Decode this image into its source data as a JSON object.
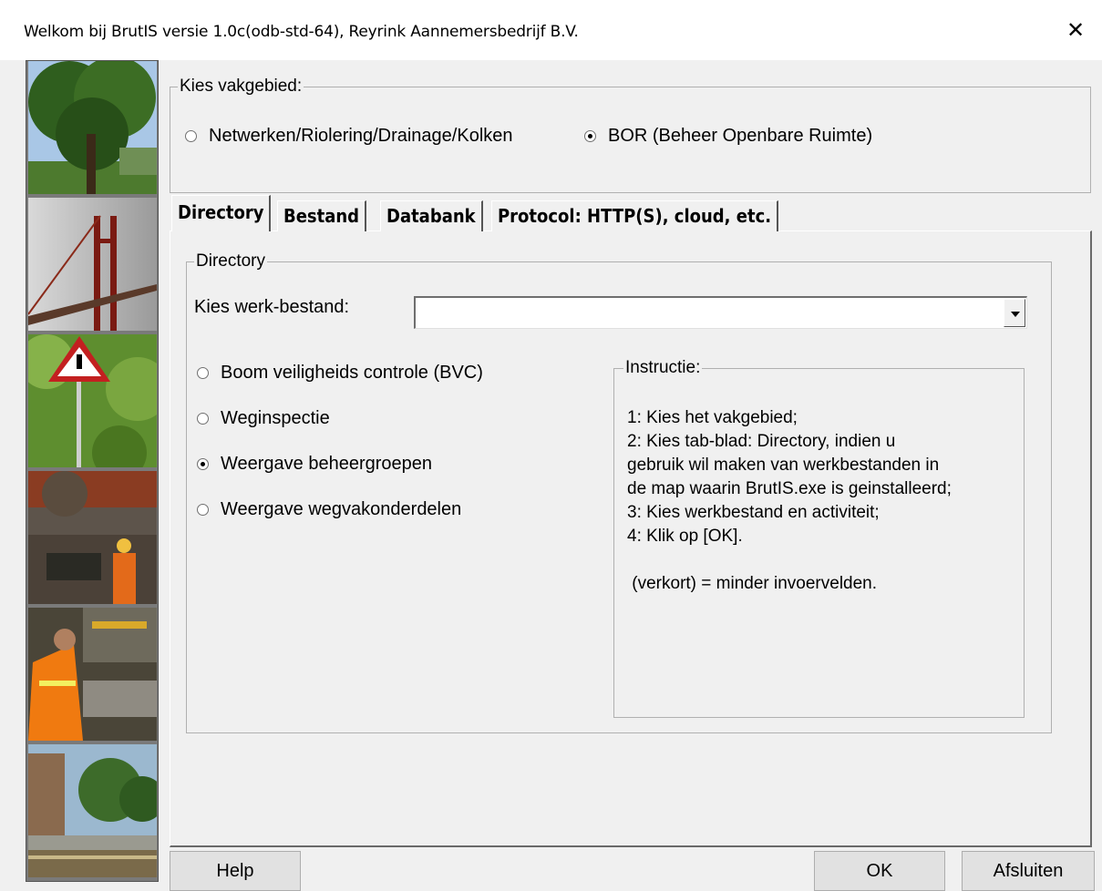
{
  "window": {
    "title": "Welkom bij BrutIS versie 1.0c(odb-std-64), Reyrink Aannemersbedrijf B.V.",
    "close_glyph": "✕"
  },
  "photos": [
    "tree-photo",
    "bridge-photo",
    "warning-sign-photo",
    "excavation-worker-photo",
    "road-worker-photo",
    "canal-street-photo"
  ],
  "vakgebied": {
    "legend": "Kies vakgebied:",
    "options": [
      {
        "label": "Netwerken/Riolering/Drainage/Kolken",
        "selected": false
      },
      {
        "label": "BOR (Beheer Openbare Ruimte)",
        "selected": true
      }
    ]
  },
  "tabs": [
    {
      "label": "Directory",
      "active": true
    },
    {
      "label": "Bestand",
      "active": false
    },
    {
      "label": "Databank",
      "active": false
    },
    {
      "label": "Protocol: HTTP(S), cloud, etc.",
      "active": false
    }
  ],
  "directory": {
    "legend": "Directory",
    "werkbestand_label": "Kies werk-bestand:",
    "werkbestand_value": "",
    "activities": [
      {
        "label": "Boom veiligheids controle (BVC)",
        "selected": false
      },
      {
        "label": "Weginspectie",
        "selected": false
      },
      {
        "label": "Weergave beheergroepen",
        "selected": true
      },
      {
        "label": "Weergave wegvakonderdelen",
        "selected": false
      }
    ]
  },
  "instructie": {
    "legend": "Instructie:",
    "text": "1: Kies het vakgebied;\n2: Kies tab-blad: Directory, indien u\ngebruik wil maken van werkbestanden in\nde map waarin BrutIS.exe is geinstalleerd;\n3: Kies werkbestand en activiteit;\n4: Klik op [OK].\n\n (verkort) = minder invoervelden."
  },
  "buttons": {
    "help": "Help",
    "ok": "OK",
    "close": "Afsluiten"
  },
  "colors": {
    "dialog_bg": "#f0f0f0",
    "title_bg": "#ffffff"
  }
}
